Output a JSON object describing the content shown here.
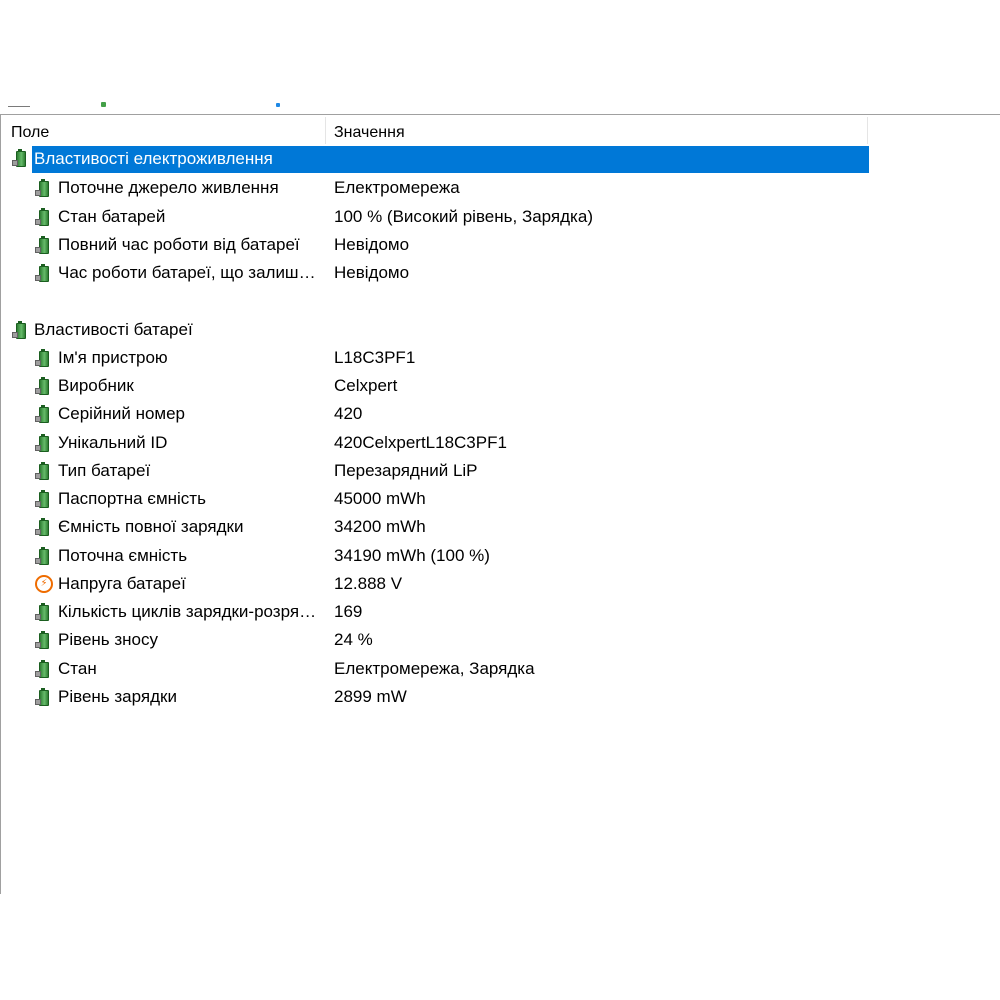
{
  "header": {
    "field": "Поле",
    "value": "Значення"
  },
  "groups": [
    {
      "title": "Властивості електроживлення",
      "items": [
        {
          "name": "Поточне джерело живлення",
          "value": "Електромережа"
        },
        {
          "name": "Стан батарей",
          "value": "100 % (Високий рівень, Зарядка)"
        },
        {
          "name": "Повний час роботи від батареї",
          "value": "Невідомо"
        },
        {
          "name": "Час роботи батареї, що залиш…",
          "value": "Невідомо"
        }
      ]
    },
    {
      "title": "Властивості батареї",
      "items": [
        {
          "name": "Ім'я пристрою",
          "value": "L18C3PF1"
        },
        {
          "name": "Виробник",
          "value": "Celxpert"
        },
        {
          "name": "Серійний номер",
          "value": "420"
        },
        {
          "name": "Унікальний ID",
          "value": "420CelxpertL18C3PF1"
        },
        {
          "name": "Тип батареї",
          "value": "Перезарядний LiP"
        },
        {
          "name": "Паспортна ємність",
          "value": "45000 mWh"
        },
        {
          "name": "Ємність повної зарядки",
          "value": "34200 mWh"
        },
        {
          "name": "Поточна ємність",
          "value": "34190 mWh  (100 %)"
        },
        {
          "name": "Напруга батареї",
          "value": "12.888 V",
          "icon": "voltage-icon"
        },
        {
          "name": "Кількість циклів зарядки-розря…",
          "value": "169"
        },
        {
          "name": "Рівень зносу",
          "value": "24 %"
        },
        {
          "name": "Стан",
          "value": "Електромережа, Зарядка"
        },
        {
          "name": "Рівень зарядки",
          "value": "2899 mW"
        }
      ]
    }
  ],
  "colors": {
    "selection": "#0078d7",
    "battery": "#43a047",
    "voltage": "#ef6c00"
  },
  "icons": {
    "default": "battery-icon",
    "voltage": "voltage-icon"
  }
}
